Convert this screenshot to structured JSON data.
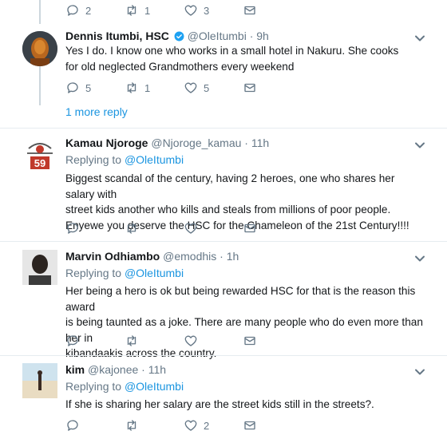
{
  "top_actions": {
    "reply_count": "2",
    "retweet_count": "1",
    "like_count": "3"
  },
  "tweets": [
    {
      "name": "Dennis Itumbi, HSC",
      "handle": "@OleItumbi",
      "time": "9h",
      "text": "Yes I do. I know one who works in a small hotel in Nakuru. She cooks for old neglected Grandmothers every weekend",
      "reply_count": "5",
      "retweet_count": "1",
      "like_count": "5",
      "more_replies": "1 more reply"
    },
    {
      "name": "Kamau Njoroge",
      "handle": "@Njoroge_kamau",
      "time": "11h",
      "replying_prefix": "Replying to",
      "replying_to": "@OleItumbi",
      "text_lines": [
        "Biggest scandal of the century, having 2 heroes, one who shares her salary with",
        "street kids another who kills and steals from millions of poor people.",
        "Enyewe you deserve the HSC for the Chameleon of the 21st Century!!!!"
      ],
      "avatar_text": "59"
    },
    {
      "name": "Marvin Odhiambo",
      "handle": "@emodhis",
      "time": "1h",
      "replying_prefix": "Replying to",
      "replying_to": "@OleItumbi",
      "text_lines": [
        "Her being a hero is ok but being rewarded HSC for that is the reason this award",
        "is being taunted as a joke. There are many people who do even more than her in",
        "kibandaakis across the country."
      ]
    },
    {
      "name": "kim",
      "handle": "@kajonee",
      "time": "11h",
      "replying_prefix": "Replying to",
      "replying_to": "@OleItumbi",
      "text": "If she is sharing her salary are the street kids still in the streets?.",
      "like_count": "2"
    }
  ],
  "colors": {
    "link": "#1b95e0",
    "muted": "#657786",
    "verified": "#1da1f2",
    "separator": "#e6ecf0"
  }
}
